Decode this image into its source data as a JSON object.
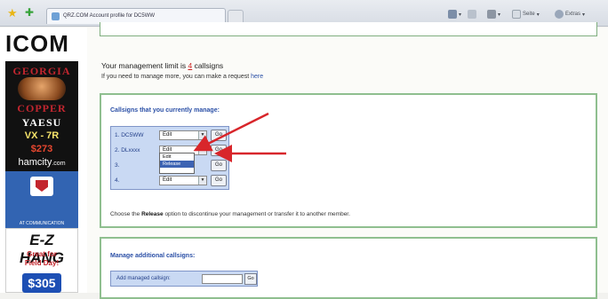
{
  "browser": {
    "tab_title": "QRZ.COM Account profile for DC5WW",
    "commands": [
      "Seite",
      "Extras"
    ]
  },
  "ads": {
    "icom": "ICOM",
    "georgia": "GEORGIA",
    "copper": "COPPER",
    "yaesu": "YAESU",
    "model": "VX - 7R",
    "price": "$273",
    "hamcity": "hamcity",
    "hamcity_suffix": ".com",
    "comm": "AT COMMUNICATION",
    "ez_hang": "E-Z HANG",
    "great_for": "Great for",
    "field_day": "Field Day!",
    "price2": "$305"
  },
  "main": {
    "management_prefix": "Your management limit is ",
    "management_count": "4",
    "management_suffix": " callsigns",
    "request_prefix": "If you need to manage more, you can make a request ",
    "request_link": "here",
    "callsigns_title": "Callsigns that you currently manage:",
    "rows": [
      {
        "label": "1.  DC5WW",
        "select": "Edit"
      },
      {
        "label": "2.  DLxxxx",
        "select": "Edit"
      },
      {
        "label": "3.",
        "select": "Edit"
      },
      {
        "label": "4.",
        "select": "Edit"
      }
    ],
    "go_label": "Go",
    "dropdown_options": [
      "Edit",
      "Release"
    ],
    "release_info_prefix": "Choose the ",
    "release_word": "Release",
    "release_info_suffix": " option to discontinue your management or transfer it to another member.",
    "additional_title": "Manage additional callsigns:",
    "add_label": "Add managed callsign:",
    "add_go": "Go"
  },
  "colors": {
    "link": "#2a4fa6",
    "box_border": "#8fbf8f",
    "table_bg": "#c9d9f3",
    "arrow": "#d8262b"
  }
}
